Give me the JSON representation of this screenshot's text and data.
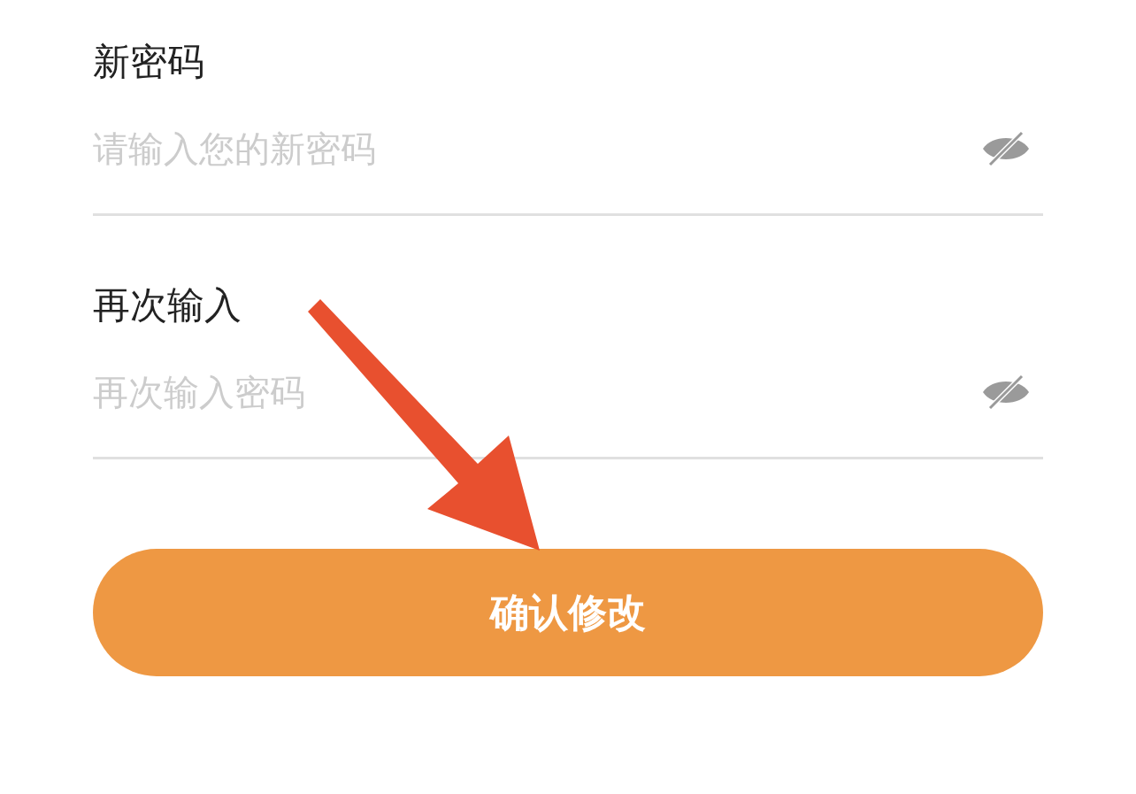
{
  "fields": [
    {
      "label": "新密码",
      "placeholder": "请输入您的新密码"
    },
    {
      "label": "再次输入",
      "placeholder": "再次输入密码"
    }
  ],
  "submit_button": {
    "label": "确认修改"
  },
  "annotation": {
    "kind": "arrow"
  }
}
